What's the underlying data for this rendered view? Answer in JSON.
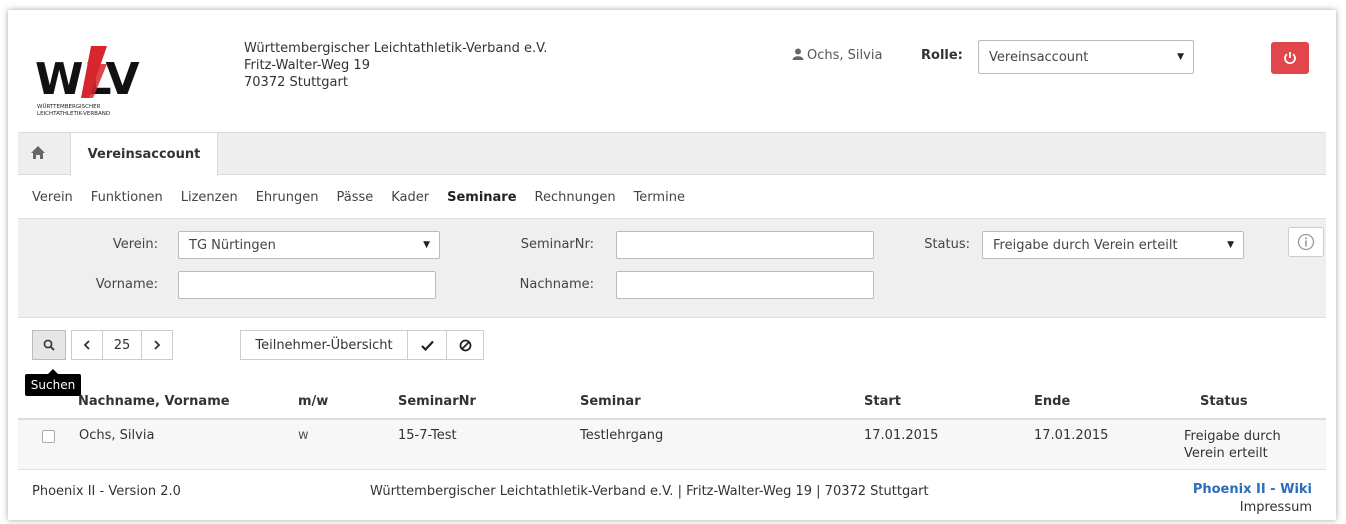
{
  "header": {
    "address_lines": [
      "Württembergischer Leichtathletik-Verband e.V.",
      "Fritz-Walter-Weg 19",
      "70372 Stuttgart"
    ],
    "logo_text": "WLV",
    "logo_caption_1": "WÜRTTEMBERGISCHER",
    "logo_caption_2": "LEICHTATHLETIK-VERBAND",
    "user_name": "Ochs, Silvia",
    "role_label": "Rolle:",
    "role_value": "Vereinsaccount",
    "colors": {
      "logout": "#e0464c",
      "logo_red": "#d8262e"
    }
  },
  "tabs": {
    "active_label": "Vereinsaccount"
  },
  "subnav": {
    "items": [
      "Verein",
      "Funktionen",
      "Lizenzen",
      "Ehrungen",
      "Pässe",
      "Kader",
      "Seminare",
      "Rechnungen",
      "Termine"
    ],
    "active": "Seminare"
  },
  "filter": {
    "verein_label": "Verein:",
    "verein_value": "TG Nürtingen",
    "seminarnr_label": "SeminarNr:",
    "seminarnr_value": "",
    "status_label": "Status:",
    "status_value": "Freigabe durch Verein erteilt",
    "vorname_label": "Vorname:",
    "vorname_value": "",
    "nachname_label": "Nachname:",
    "nachname_value": ""
  },
  "toolbar": {
    "page_size": "25",
    "overview_label": "Teilnehmer-Übersicht",
    "search_tooltip": "Suchen"
  },
  "table": {
    "headers": [
      "Nachname, Vorname",
      "m/w",
      "SeminarNr",
      "Seminar",
      "Start",
      "Ende",
      "Status"
    ],
    "rows": [
      {
        "name": "Ochs, Silvia",
        "mw": "w",
        "seminarnr": "15-7-Test",
        "seminar": "Testlehrgang",
        "start": "17.01.2015",
        "ende": "17.01.2015",
        "status_1": "Freigabe durch",
        "status_2": "Verein erteilt"
      }
    ]
  },
  "footer": {
    "version": "Phoenix II - Version 2.0",
    "address": "Württembergischer Leichtathletik-Verband e.V. | Fritz-Walter-Weg 19 | 70372 Stuttgart",
    "wiki": "Phoenix II - Wiki",
    "impressum": "Impressum"
  }
}
